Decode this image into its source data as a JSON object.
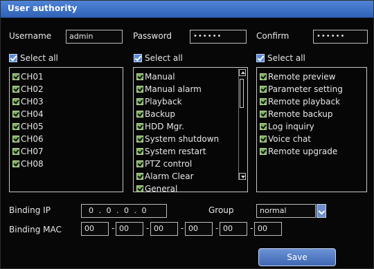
{
  "window": {
    "title": "User authority"
  },
  "credentials": {
    "username_label": "Username",
    "username_value": "admin",
    "password_label": "Password",
    "password_value": "••••••",
    "confirm_label": "Confirm",
    "confirm_value": "••••••"
  },
  "channels": {
    "select_all_label": "Select all",
    "items": [
      "CH01",
      "CH02",
      "CH03",
      "CH04",
      "CH05",
      "CH06",
      "CH07",
      "CH08"
    ]
  },
  "local_permissions": {
    "select_all_label": "Select all",
    "items": [
      "Manual",
      "Manual alarm",
      "Playback",
      "Backup",
      "HDD Mgr.",
      "System shutdown",
      "System restart",
      "PTZ control",
      "Alarm Clear",
      "General"
    ]
  },
  "remote_permissions": {
    "select_all_label": "Select all",
    "items": [
      "Remote preview",
      "Parameter setting",
      "Remote playback",
      "Remote backup",
      "Log inquiry",
      "Voice chat",
      "Remote upgrade"
    ]
  },
  "network": {
    "binding_ip_label": "Binding IP",
    "binding_ip_value": "0 . 0 . 0 . 0",
    "group_label": "Group",
    "group_value": "normal",
    "binding_mac_label": "Binding MAC",
    "mac_values": [
      "00",
      "00",
      "00",
      "00",
      "00",
      "00"
    ],
    "mac_separator": "-"
  },
  "actions": {
    "save_label": "Save"
  },
  "colors": {
    "title_bar": "#3d72c9",
    "accent": "#6c93d6"
  }
}
